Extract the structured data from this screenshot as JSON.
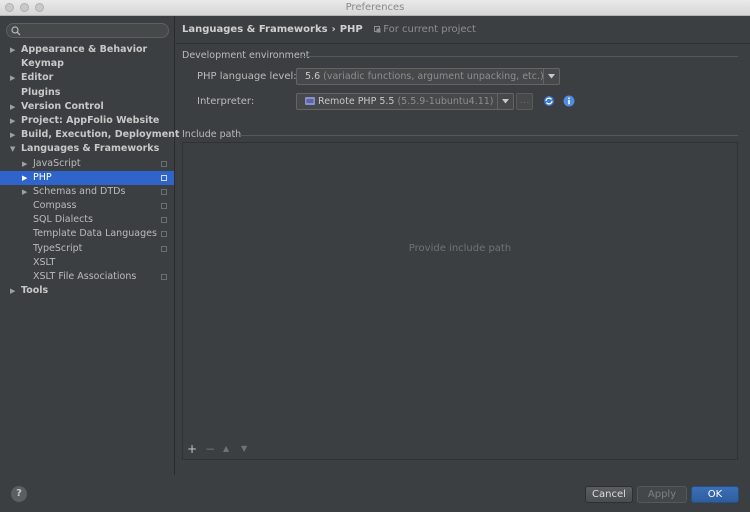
{
  "window": {
    "title": "Preferences"
  },
  "sidebar": {
    "search_placeholder": "",
    "items": [
      {
        "label": "Appearance & Behavior",
        "level": 0,
        "arrow": "▶",
        "bold": true,
        "selected": false,
        "mark": false
      },
      {
        "label": "Keymap",
        "level": 0,
        "arrow": "",
        "bold": true,
        "selected": false,
        "mark": false
      },
      {
        "label": "Editor",
        "level": 0,
        "arrow": "▶",
        "bold": true,
        "selected": false,
        "mark": false
      },
      {
        "label": "Plugins",
        "level": 0,
        "arrow": "",
        "bold": true,
        "selected": false,
        "mark": false
      },
      {
        "label": "Version Control",
        "level": 0,
        "arrow": "▶",
        "bold": true,
        "selected": false,
        "mark": false
      },
      {
        "label": "Project: AppFolio Website",
        "level": 0,
        "arrow": "▶",
        "bold": true,
        "selected": false,
        "mark": false
      },
      {
        "label": "Build, Execution, Deployment",
        "level": 0,
        "arrow": "▶",
        "bold": true,
        "selected": false,
        "mark": false
      },
      {
        "label": "Languages & Frameworks",
        "level": 0,
        "arrow": "▼",
        "bold": true,
        "selected": false,
        "mark": false
      },
      {
        "label": "JavaScript",
        "level": 1,
        "arrow": "▶",
        "bold": false,
        "selected": false,
        "mark": true
      },
      {
        "label": "PHP",
        "level": 1,
        "arrow": "▶",
        "bold": false,
        "selected": true,
        "mark": true
      },
      {
        "label": "Schemas and DTDs",
        "level": 1,
        "arrow": "▶",
        "bold": false,
        "selected": false,
        "mark": true
      },
      {
        "label": "Compass",
        "level": 1,
        "arrow": "",
        "bold": false,
        "selected": false,
        "mark": true
      },
      {
        "label": "SQL Dialects",
        "level": 1,
        "arrow": "",
        "bold": false,
        "selected": false,
        "mark": true
      },
      {
        "label": "Template Data Languages",
        "level": 1,
        "arrow": "",
        "bold": false,
        "selected": false,
        "mark": true
      },
      {
        "label": "TypeScript",
        "level": 1,
        "arrow": "",
        "bold": false,
        "selected": false,
        "mark": true
      },
      {
        "label": "XSLT",
        "level": 1,
        "arrow": "",
        "bold": false,
        "selected": false,
        "mark": false
      },
      {
        "label": "XSLT File Associations",
        "level": 1,
        "arrow": "",
        "bold": false,
        "selected": false,
        "mark": true
      },
      {
        "label": "Tools",
        "level": 0,
        "arrow": "▶",
        "bold": true,
        "selected": false,
        "mark": false
      }
    ]
  },
  "breadcrumb": {
    "parent": "Languages & Frameworks",
    "separator": "›",
    "current": "PHP",
    "scope": "For current project"
  },
  "dev_env": {
    "title": "Development environment",
    "language_level_label": "PHP language level:",
    "language_level_value": "5.6",
    "language_level_desc": "(variadic functions, argument unpacking, etc.)",
    "interpreter_label": "Interpreter:",
    "interpreter_value": "Remote PHP 5.5",
    "interpreter_version": "(5.5.9-1ubuntu4.11)",
    "more_label": "…"
  },
  "include_path": {
    "title": "Include path",
    "empty_text": "Provide include path",
    "toolbar": {
      "add": "+",
      "remove": "−",
      "up": "▲",
      "down": "▼"
    }
  },
  "buttons": {
    "help": "?",
    "cancel": "Cancel",
    "apply": "Apply",
    "ok": "OK"
  },
  "colors": {
    "selection": "#2f65ca",
    "ok_button": "#3b6fb6",
    "background": "#3c3f41"
  }
}
